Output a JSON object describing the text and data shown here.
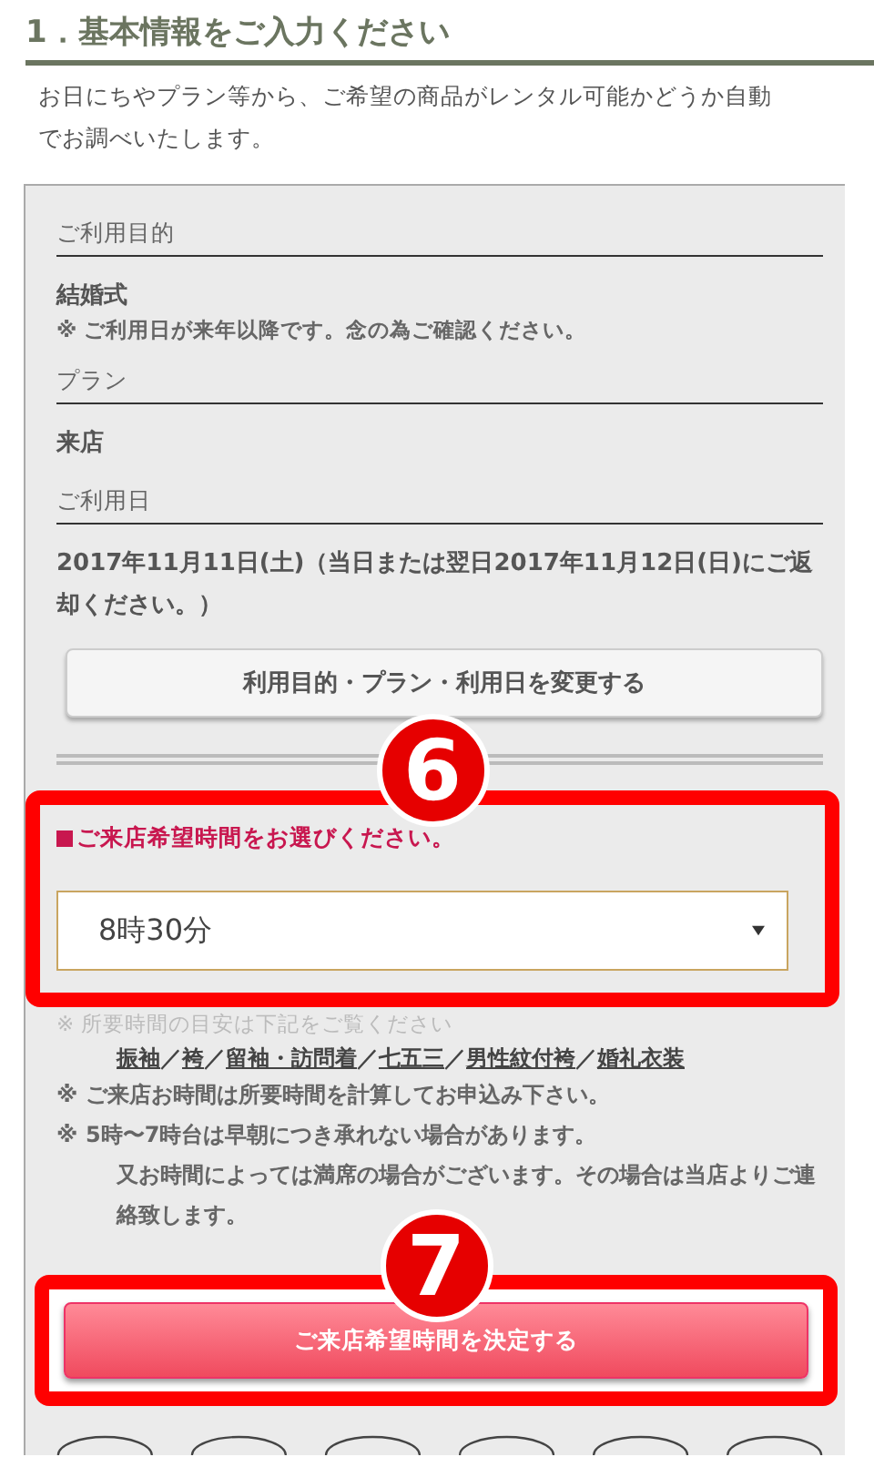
{
  "heading": "1．基本情報をご入力ください",
  "intro": [
    "お日にちやプラン等から、ご希望の商品がレンタル可能かどうか自動",
    "でお調べいたします。"
  ],
  "summary": [
    {
      "label": "ご利用目的",
      "value": "結婚式",
      "note": "※ ご利用日が来年以降です。念の為ご確認ください。"
    },
    {
      "label": "プラン",
      "value": "来店"
    },
    {
      "label": "ご利用日",
      "value": "2017年11月11日(土)（当日または翌日2017年11月12日(日)にご返却ください。）"
    }
  ],
  "change_button": "利用目的・プラン・利用日を変更する",
  "time": {
    "callout": "6",
    "prompt": "ご来店希望時間をお選びください。",
    "value": "8時30分"
  },
  "hint": "※ 所要時間の目安は下記をご覧ください",
  "separator": "／",
  "links": [
    "振袖",
    "袴",
    "留袖・訪問着",
    "七五三",
    "男性紋付袴",
    "婚礼衣装"
  ],
  "notes": [
    {
      "mark": "※",
      "text": "ご来店お時間は所要時間を計算してお申込み下さい。"
    },
    {
      "mark": "※",
      "text": "5時〜7時台は早朝につき承れない場合があります。"
    },
    {
      "text": "又お時間によっては満席の場合がございます。その場合は当店よりご連絡致します。"
    }
  ],
  "submit": {
    "callout": "7",
    "label": "ご来店希望時間を決定する"
  }
}
